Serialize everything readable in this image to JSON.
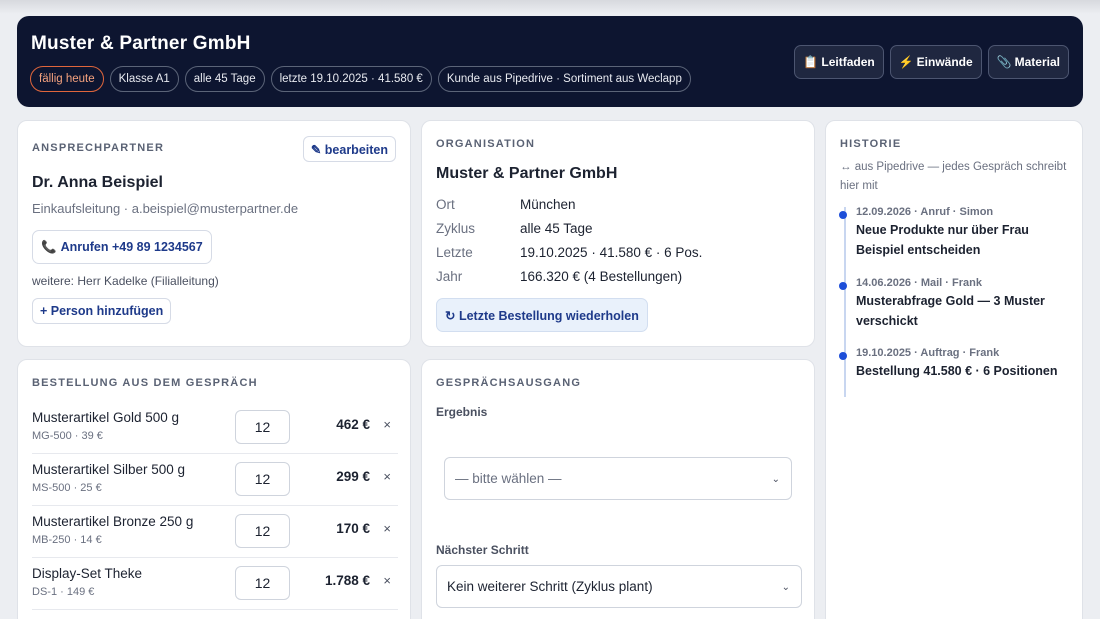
{
  "header": {
    "title": "Muster & Partner GmbH",
    "chips": [
      "fällig heute",
      "Klasse A1",
      "alle 45 Tage",
      "letzte 19.10.2025 · 41.580 €",
      "Kunde aus Pipedrive · Sortiment aus Weclapp"
    ],
    "buttons": [
      {
        "icon": "clipboard-icon",
        "glyph": "📋",
        "label": "Leitfaden"
      },
      {
        "icon": "lightning-icon",
        "glyph": "⚡",
        "label": "Einwände"
      },
      {
        "icon": "paperclip-icon",
        "glyph": "📎",
        "label": "Material"
      }
    ]
  },
  "contact": {
    "section_label": "ANSPRECHPARTNER",
    "edit_label": "✎ bearbeiten",
    "name": "Dr. Anna Beispiel",
    "role_email": "Einkaufsleitung · a.beispiel@musterpartner.de",
    "call_label": "Anrufen +49 89 1234567",
    "more": "weitere: Herr Kadelke (Filialleitung)",
    "add_label": "+ Person hinzufügen"
  },
  "organisation": {
    "section_label": "ORGANISATION",
    "name": "Muster & Partner GmbH",
    "rows": [
      {
        "k": "Ort",
        "v": "München"
      },
      {
        "k": "Zyklus",
        "v": "alle 45 Tage"
      },
      {
        "k": "Letzte",
        "v": "19.10.2025 · 41.580 € · 6 Pos."
      },
      {
        "k": "Jahr",
        "v": "166.320 € (4 Bestellungen)"
      }
    ],
    "reorder_label": "↻ Letzte Bestellung wiederholen"
  },
  "history": {
    "section_label": "HISTORIE",
    "subtitle": "↔ aus Pipedrive — jedes Gespräch schreibt hier mit",
    "items": [
      {
        "meta": "12.09.2026 · Anruf · Simon",
        "text": "Neue Produkte nur über Frau Beispiel entscheiden"
      },
      {
        "meta": "14.06.2026 · Mail · Frank",
        "text": "Musterabfrage Gold — 3 Muster verschickt"
      },
      {
        "meta": "19.10.2025 · Auftrag · Frank",
        "text": "Bestellung 41.580 € · 6 Positionen"
      }
    ]
  },
  "order": {
    "section_label": "BESTELLUNG AUS DEM GESPRÄCH",
    "remove_glyph": "×",
    "rows": [
      {
        "name": "Musterartikel Gold 500 g",
        "sub": "MG-500 · 39 €",
        "qty": "12",
        "price": "462 €"
      },
      {
        "name": "Musterartikel Silber 500 g",
        "sub": "MS-500 · 25 €",
        "qty": "12",
        "price": "299 €"
      },
      {
        "name": "Musterartikel Bronze 250 g",
        "sub": "MB-250 · 14 €",
        "qty": "12",
        "price": "170 €"
      },
      {
        "name": "Display-Set Theke",
        "sub": "DS-1 · 149 €",
        "qty": "12",
        "price": "1.788 €"
      }
    ]
  },
  "outcome": {
    "section_label": "GESPRÄCHSAUSGANG",
    "result_label": "Ergebnis",
    "result_placeholder": "— bitte wählen —",
    "next_label": "Nächster Schritt",
    "next_value": "Kein weiterer Schritt (Zyklus plant)"
  }
}
